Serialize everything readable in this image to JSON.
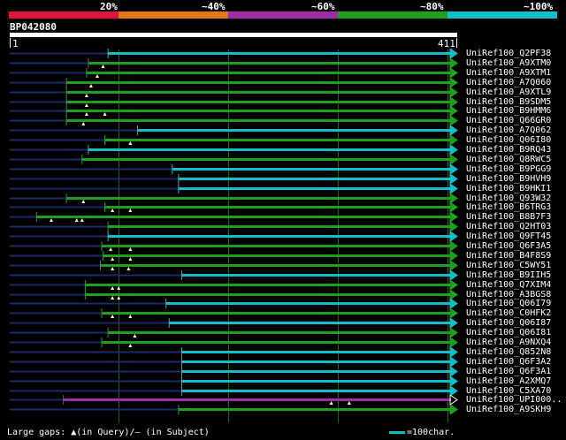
{
  "legend": {
    "labels": [
      "20%",
      "~40%",
      "~60%",
      "~80%",
      "~100%"
    ],
    "colors": [
      "#e0143c",
      "#e07818",
      "#a02ca8",
      "#1ea01e",
      "#12bec8"
    ]
  },
  "query": {
    "id": "BP042080",
    "start": "1",
    "end": "411"
  },
  "colors": {
    "cyan": "#12bec8",
    "green": "#1ea01e",
    "magenta": "#a02ca8",
    "navy": "#1a2a6a"
  },
  "hits": [
    {
      "name": "UniRef100_Q2PF38",
      "start": 0.22,
      "color": "cyan",
      "gaps": []
    },
    {
      "name": "UniRef100_A9XTM0",
      "start": 0.176,
      "color": "green",
      "gaps": [
        0.209
      ]
    },
    {
      "name": "UniRef100_A9XTM1",
      "start": 0.172,
      "color": "green",
      "gaps": [
        0.196
      ]
    },
    {
      "name": "UniRef100_A7Q060",
      "start": 0.127,
      "color": "green",
      "gaps": [
        0.182
      ]
    },
    {
      "name": "UniRef100_A9XTL9",
      "start": 0.127,
      "color": "green",
      "gaps": [
        0.172
      ]
    },
    {
      "name": "UniRef100_B9SDM5",
      "start": 0.127,
      "color": "green",
      "gaps": [
        0.172
      ]
    },
    {
      "name": "UniRef100_B9HMM6",
      "start": 0.127,
      "color": "green",
      "gaps": [
        0.172,
        0.213
      ]
    },
    {
      "name": "UniRef100_Q66GR0",
      "start": 0.127,
      "color": "green",
      "gaps": [
        0.165
      ]
    },
    {
      "name": "UniRef100_A7Q062",
      "start": 0.286,
      "color": "cyan",
      "gaps": []
    },
    {
      "name": "UniRef100_Q06I80",
      "start": 0.213,
      "color": "green",
      "gaps": [
        0.27
      ]
    },
    {
      "name": "UniRef100_B9RQ43",
      "start": 0.176,
      "color": "cyan",
      "gaps": []
    },
    {
      "name": "UniRef100_Q8RWC5",
      "start": 0.162,
      "color": "green",
      "gaps": []
    },
    {
      "name": "UniRef100_B9PGG9",
      "start": 0.364,
      "color": "cyan",
      "gaps": []
    },
    {
      "name": "UniRef100_B9HVH9",
      "start": 0.378,
      "color": "cyan",
      "gaps": []
    },
    {
      "name": "UniRef100_B9HKI1",
      "start": 0.378,
      "color": "cyan",
      "gaps": []
    },
    {
      "name": "UniRef100_Q93W32",
      "start": 0.127,
      "color": "green",
      "gaps": [
        0.165
      ]
    },
    {
      "name": "UniRef100_B6TRG3",
      "start": 0.213,
      "color": "green",
      "gaps": [
        0.23,
        0.27
      ]
    },
    {
      "name": "UniRef100_B8B7F3",
      "start": 0.06,
      "color": "green",
      "gaps": [
        0.093,
        0.15,
        0.162
      ]
    },
    {
      "name": "UniRef100_Q2HT03",
      "start": 0.22,
      "color": "green",
      "gaps": []
    },
    {
      "name": "UniRef100_Q9FT45",
      "start": 0.22,
      "color": "cyan",
      "gaps": []
    },
    {
      "name": "UniRef100_Q6F3A5",
      "start": 0.206,
      "color": "green",
      "gaps": [
        0.226,
        0.27
      ]
    },
    {
      "name": "UniRef100_B4F8S9",
      "start": 0.209,
      "color": "green",
      "gaps": [
        0.23,
        0.27
      ]
    },
    {
      "name": "UniRef100_C5WY51",
      "start": 0.203,
      "color": "green",
      "gaps": [
        0.23,
        0.266
      ]
    },
    {
      "name": "UniRef100_B9IIH5",
      "start": 0.385,
      "color": "cyan",
      "gaps": []
    },
    {
      "name": "UniRef100_Q7XIM4",
      "start": 0.169,
      "color": "green",
      "gaps": [
        0.23,
        0.244
      ]
    },
    {
      "name": "UniRef100_A3BGS8",
      "start": 0.169,
      "color": "green",
      "gaps": [
        0.23,
        0.244
      ]
    },
    {
      "name": "UniRef100_Q06I79",
      "start": 0.35,
      "color": "cyan",
      "gaps": []
    },
    {
      "name": "UniRef100_C0HFK2",
      "start": 0.206,
      "color": "green",
      "gaps": [
        0.23,
        0.27
      ]
    },
    {
      "name": "UniRef100_Q06I87",
      "start": 0.357,
      "color": "cyan",
      "gaps": []
    },
    {
      "name": "UniRef100_Q06I81",
      "start": 0.22,
      "color": "green",
      "gaps": [
        0.28
      ]
    },
    {
      "name": "UniRef100_A9NXQ4",
      "start": 0.206,
      "color": "green",
      "gaps": [
        0.27
      ]
    },
    {
      "name": "UniRef100_Q852N8",
      "start": 0.385,
      "color": "cyan",
      "gaps": []
    },
    {
      "name": "UniRef100_Q6F3A2",
      "start": 0.385,
      "color": "cyan",
      "gaps": []
    },
    {
      "name": "UniRef100_Q6F3A1",
      "start": 0.385,
      "color": "cyan",
      "gaps": []
    },
    {
      "name": "UniRef100_A2XMQ7",
      "start": 0.385,
      "color": "cyan",
      "gaps": []
    },
    {
      "name": "UniRef100_C5XA70",
      "start": 0.385,
      "color": "cyan",
      "gaps": []
    },
    {
      "name": "UniRef100_UPI000..",
      "start": 0.12,
      "color": "magenta",
      "gaps": [
        0.72,
        0.76
      ]
    },
    {
      "name": "UniRef100_A9SKH9",
      "start": 0.378,
      "color": "green",
      "gaps": []
    }
  ],
  "footer": {
    "text": "Large gaps: ▲(in Query)/— (in Subject)",
    "scale": "=100char."
  }
}
